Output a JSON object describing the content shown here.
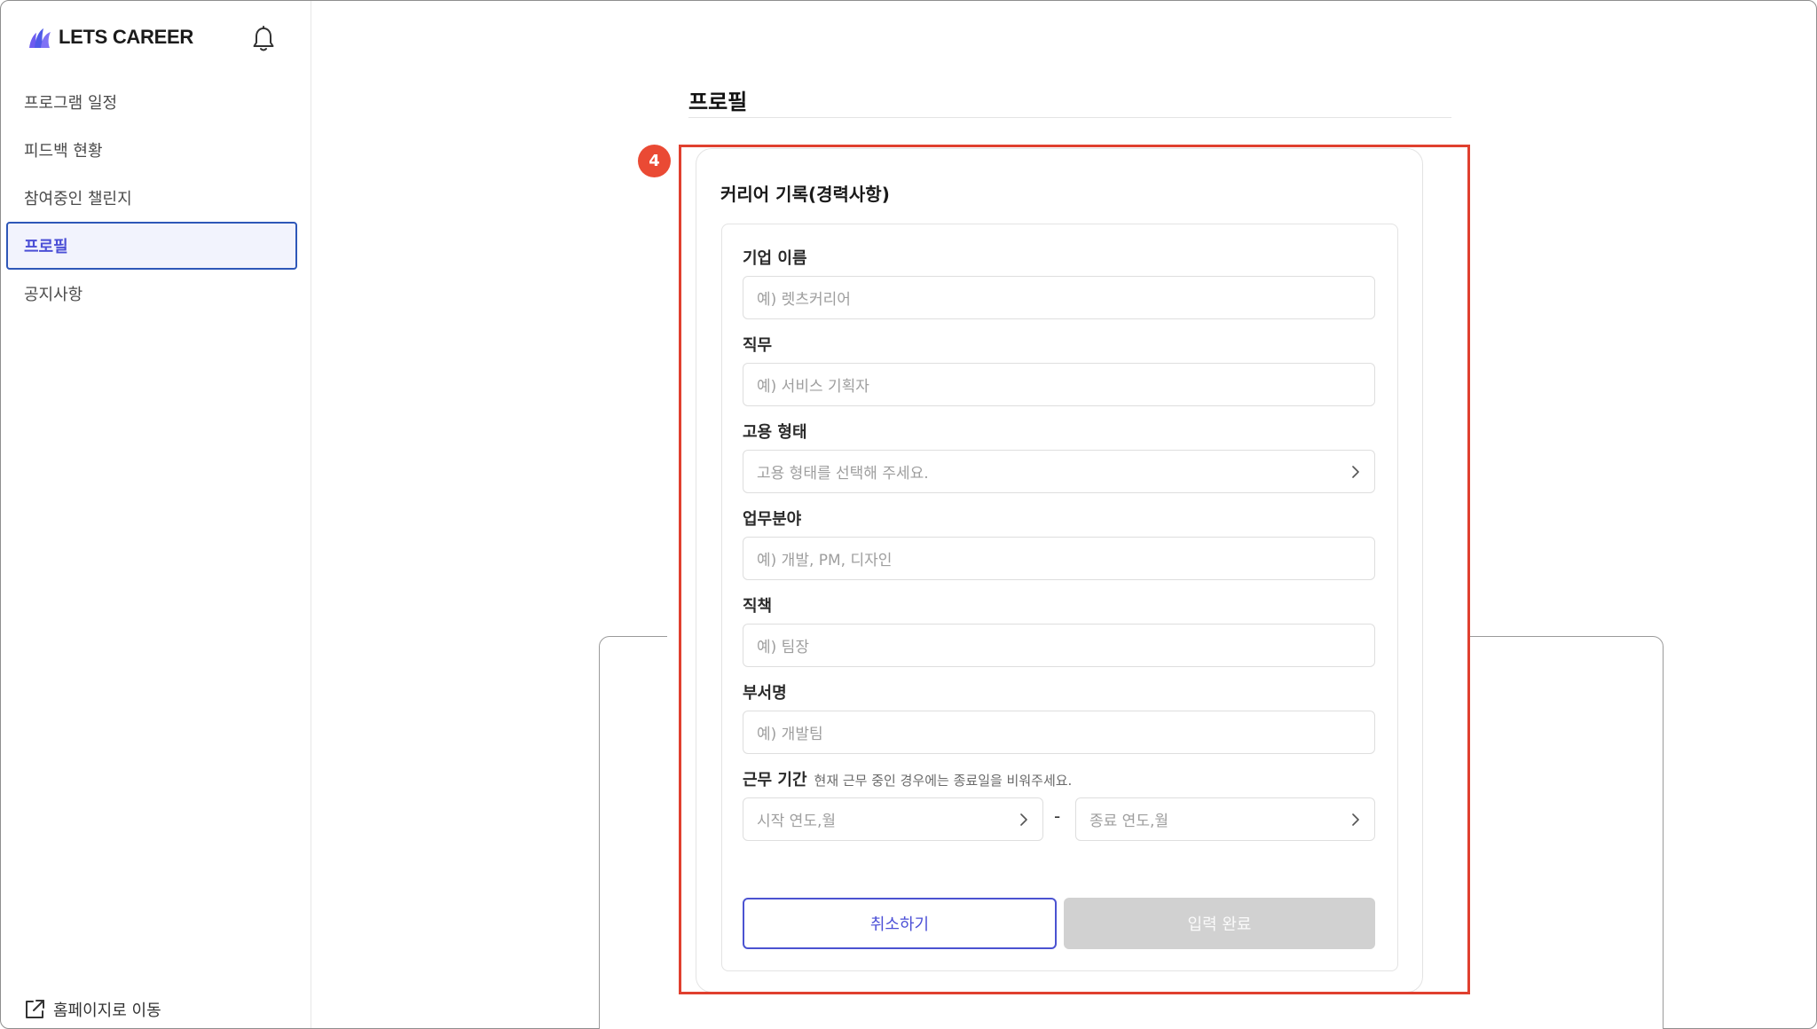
{
  "app": {
    "name": "LETS CAREER"
  },
  "sidebar": {
    "items": [
      {
        "label": "프로그램 일정",
        "active": false
      },
      {
        "label": "피드백 현황",
        "active": false
      },
      {
        "label": "참여중인 챌린지",
        "active": false
      },
      {
        "label": "프로필",
        "active": true
      },
      {
        "label": "공지사항",
        "active": false
      }
    ],
    "homepage_link": "홈페이지로 이동",
    "icons": {
      "notification": "bell-icon",
      "external": "external-link-icon"
    }
  },
  "main": {
    "title": "프로필"
  },
  "annotation": {
    "step": "4",
    "color": "#e0402f"
  },
  "form": {
    "title": "커리어 기록(경력사항)",
    "fields": {
      "company": {
        "label": "기업 이름",
        "placeholder": "예) 렛츠커리어"
      },
      "job": {
        "label": "직무",
        "placeholder": "예) 서비스 기획자"
      },
      "employment_type": {
        "label": "고용 형태",
        "placeholder": "고용 형태를 선택해 주세요."
      },
      "work_area": {
        "label": "업무분야",
        "placeholder": "예) 개발, PM, 디자인"
      },
      "position": {
        "label": "직책",
        "placeholder": "예) 팀장"
      },
      "department": {
        "label": "부서명",
        "placeholder": "예) 개발팀"
      },
      "period": {
        "label": "근무 기간",
        "hint": "현재 근무 중인 경우에는 종료일을 비워주세요.",
        "start_placeholder": "시작 연도,월",
        "separator": "-",
        "end_placeholder": "종료 연도,월"
      }
    },
    "cancel_label": "취소하기",
    "submit_label": "입력 완료"
  },
  "colors": {
    "accent": "#4b4fd6",
    "active_border": "#2e57b8",
    "disabled": "#d1d1d1"
  }
}
